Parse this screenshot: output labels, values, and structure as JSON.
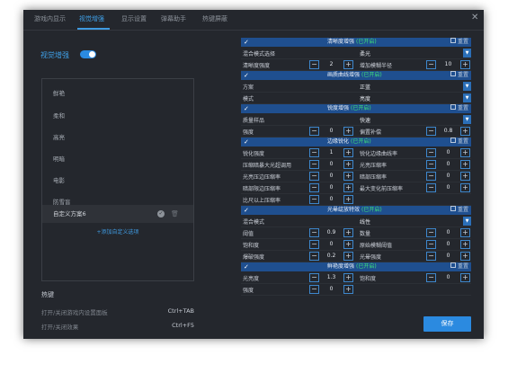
{
  "tabs": [
    "游戏内显示",
    "视觉增强",
    "显示设置",
    "弹幕助手",
    "热键屏蔽"
  ],
  "active_tab": 1,
  "enhance_label": "视觉增强",
  "enhance_toggle": true,
  "presets": [
    "鲜艳",
    "柔和",
    "高亮",
    "明暗",
    "电影",
    "防雪盲",
    "自定义方案6"
  ],
  "selected_preset": 6,
  "add_scheme": "+添加自定义选项",
  "hotkeys_title": "热键",
  "hotkeys": [
    {
      "label": "打开/关闭游戏内设置面板",
      "key": "Ctrl+TAB"
    },
    {
      "label": "打开/关闭效果",
      "key": "Ctrl+F5"
    }
  ],
  "section_status": "(已开启)",
  "reset_label": "重置",
  "sections": [
    {
      "title": "清晰度增强",
      "rows": [
        {
          "left": {
            "type": "dropdown-label",
            "label": "混合模式选择"
          },
          "right": {
            "type": "dropdown",
            "value": "柔光"
          }
        },
        {
          "left": {
            "type": "stepper",
            "label": "清晰度强度",
            "value": "2"
          },
          "right": {
            "type": "stepper",
            "label": "增加模糊半径",
            "value": "10"
          }
        }
      ]
    },
    {
      "title": "画质曲线增强",
      "rows": [
        {
          "left": {
            "type": "dropdown-label",
            "label": "方案"
          },
          "right": {
            "type": "dropdown",
            "value": "正蓝"
          }
        },
        {
          "left": {
            "type": "dropdown-label",
            "label": "模式"
          },
          "right": {
            "type": "dropdown",
            "value": "亮度"
          }
        }
      ]
    },
    {
      "title": "锐度增强",
      "rows": [
        {
          "left": {
            "type": "dropdown-label",
            "label": "质量样品"
          },
          "right": {
            "type": "dropdown",
            "value": "快速"
          }
        },
        {
          "left": {
            "type": "stepper",
            "label": "强度",
            "value": "0"
          },
          "right": {
            "type": "stepper",
            "label": "偏置补偿",
            "value": "0.8"
          }
        }
      ]
    },
    {
      "title": "边缘锐化",
      "rows": [
        {
          "left": {
            "type": "stepper",
            "label": "锐化强度",
            "value": "1"
          },
          "right": {
            "type": "stepper",
            "label": "锐化边缘曲线率",
            "value": "0"
          }
        },
        {
          "left": {
            "type": "stepper",
            "label": "压缩暗暴大光超调用",
            "value": "0"
          },
          "right": {
            "type": "stepper",
            "label": "光亮压缩率",
            "value": "0"
          }
        },
        {
          "left": {
            "type": "stepper",
            "label": "光亮压边压缩率",
            "value": "0"
          },
          "right": {
            "type": "stepper",
            "label": "暗部压缩率",
            "value": "0"
          }
        },
        {
          "left": {
            "type": "stepper",
            "label": "暗部限边压缩率",
            "value": "0"
          },
          "right": {
            "type": "stepper",
            "label": "最大变化前压缩率",
            "value": "0"
          }
        },
        {
          "left": {
            "type": "stepper",
            "label": "比尺以上压缩率",
            "value": "0"
          },
          "right": null
        }
      ]
    },
    {
      "title": "光晕绽放特效",
      "rows": [
        {
          "left": {
            "type": "dropdown-label",
            "label": "混合模式"
          },
          "right": {
            "type": "dropdown",
            "value": "线性"
          }
        },
        {
          "left": {
            "type": "stepper",
            "label": "阈值",
            "value": "0.9"
          },
          "right": {
            "type": "stepper",
            "label": "数量",
            "value": "0"
          }
        },
        {
          "left": {
            "type": "stepper",
            "label": "饱和度",
            "value": "0"
          },
          "right": {
            "type": "stepper",
            "label": "原始模糊阈值",
            "value": "0"
          }
        },
        {
          "left": {
            "type": "stepper",
            "label": "爆破强度",
            "value": "0.2"
          },
          "right": {
            "type": "stepper",
            "label": "光晕强度",
            "value": "0"
          }
        }
      ]
    },
    {
      "title": "鲜艳度增强",
      "rows": [
        {
          "left": {
            "type": "stepper",
            "label": "光亮度",
            "value": "1.3"
          },
          "right": {
            "type": "stepper",
            "label": "饱和度",
            "value": "0"
          }
        },
        {
          "left": {
            "type": "stepper",
            "label": "强度",
            "value": "0"
          },
          "right": null
        }
      ]
    }
  ],
  "save_label": "保存"
}
